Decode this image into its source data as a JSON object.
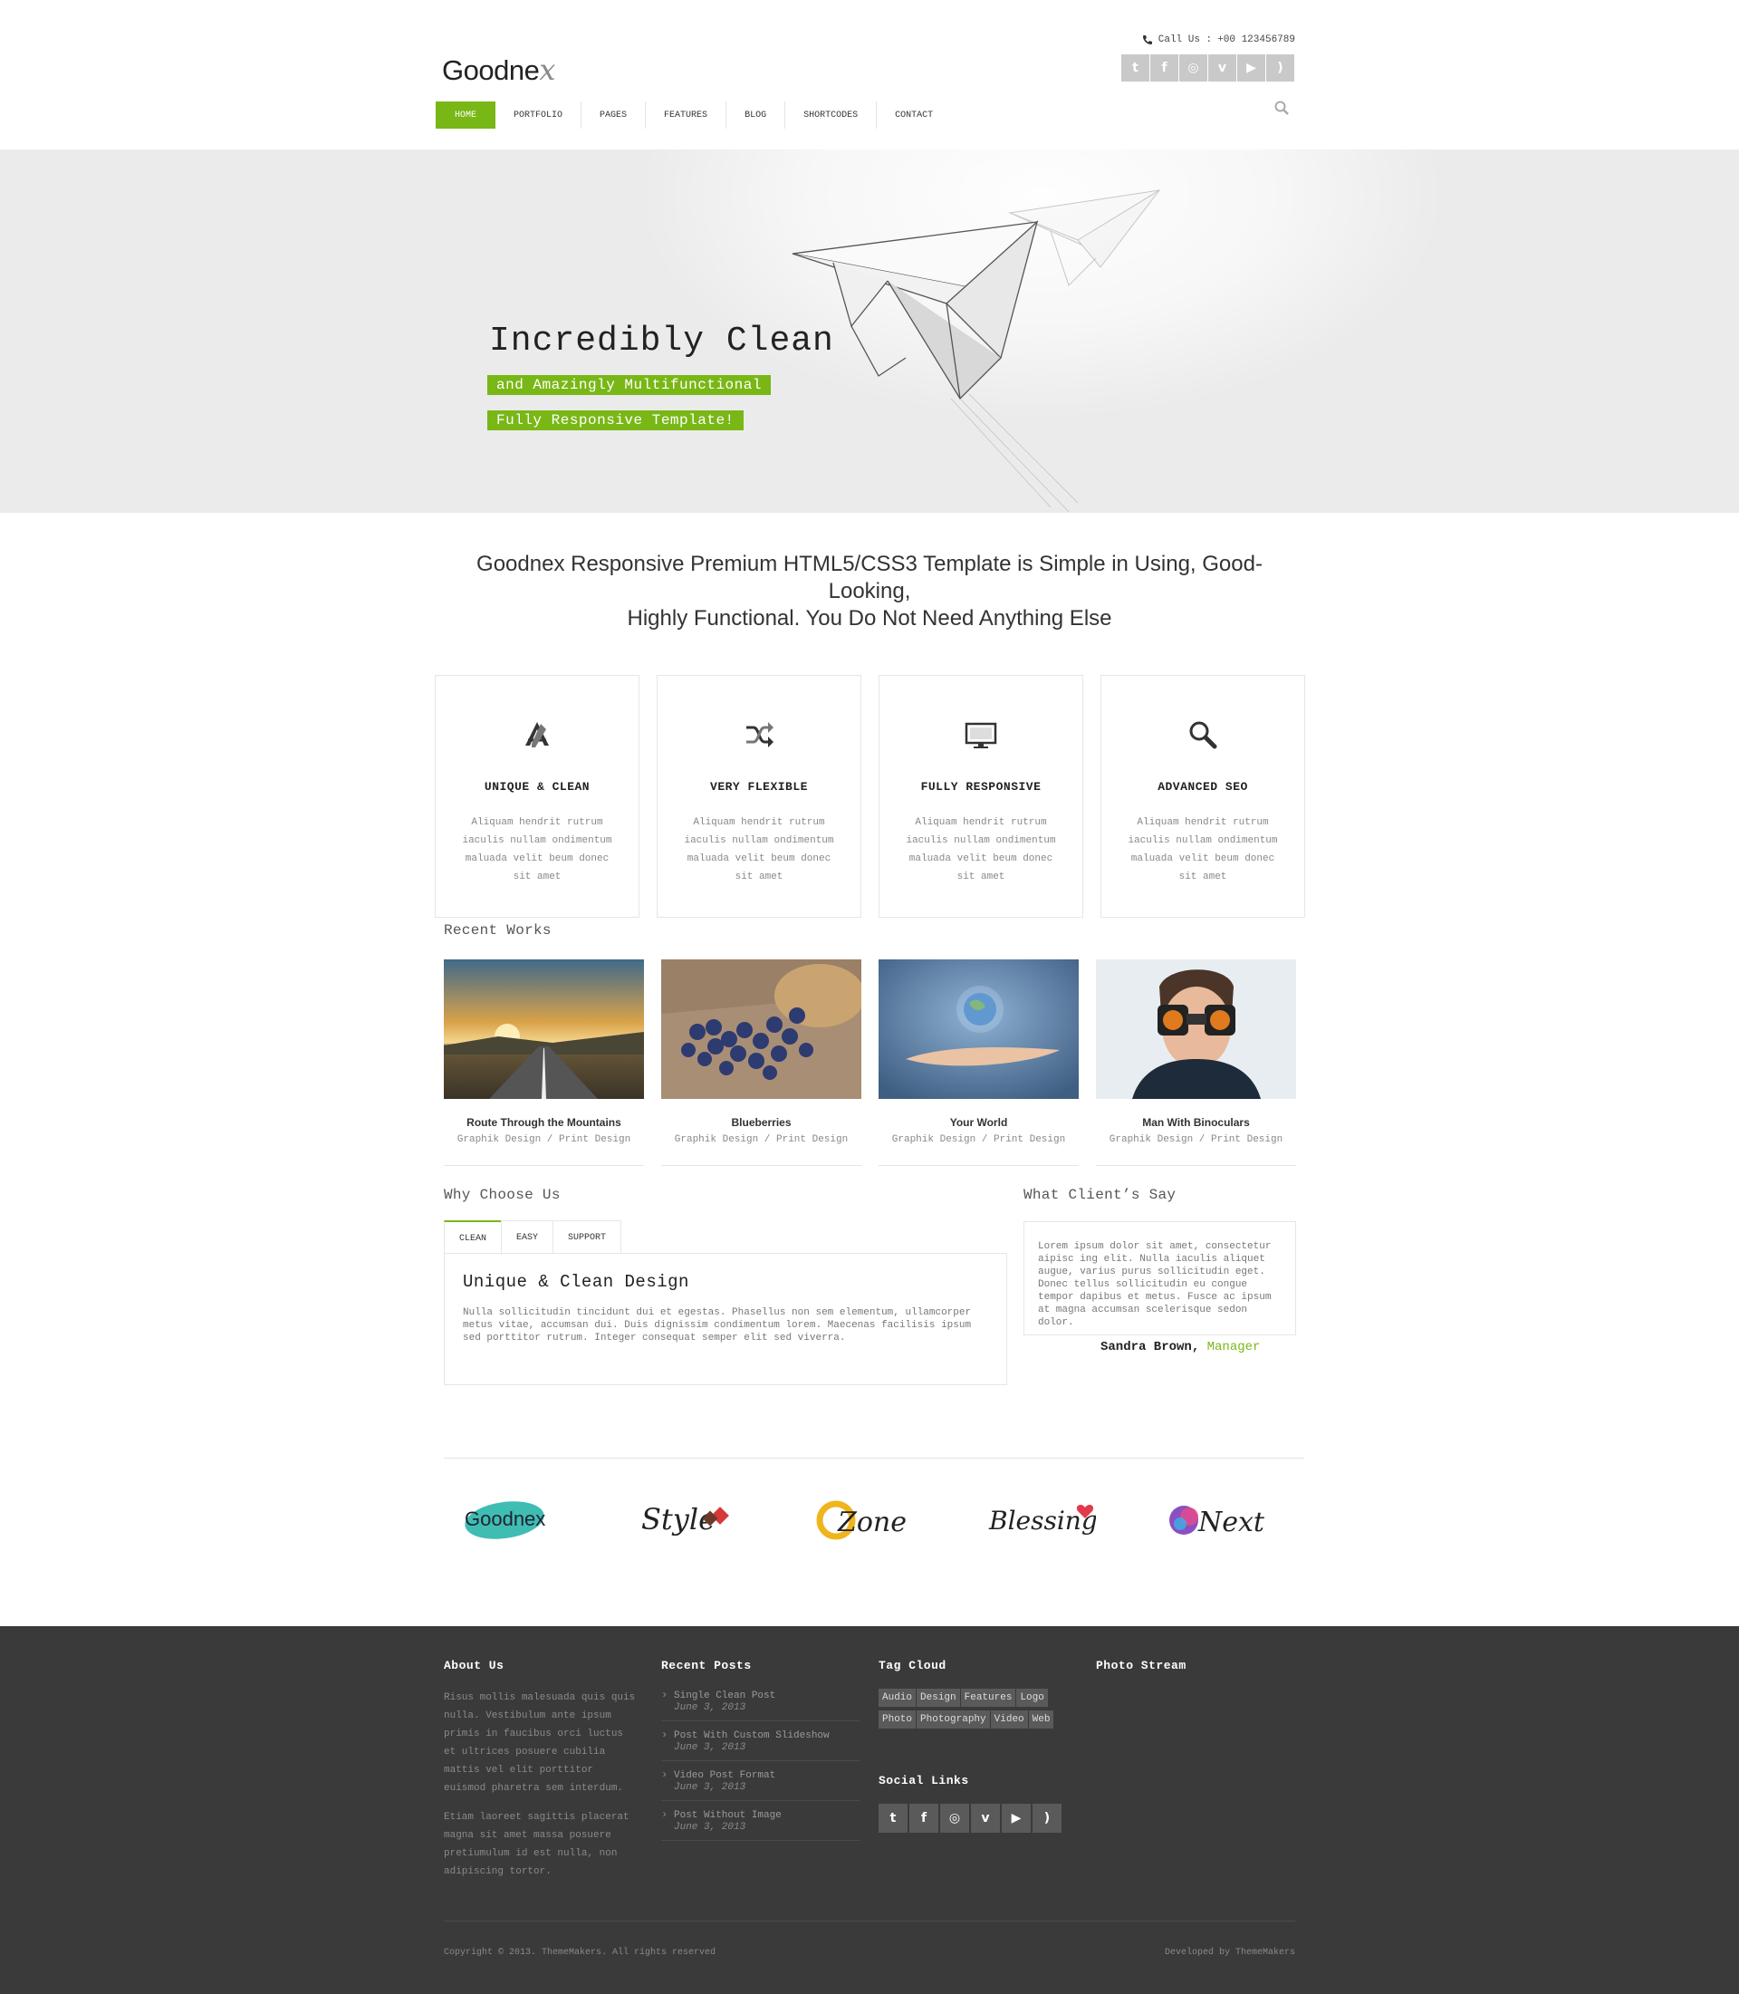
{
  "header": {
    "logo_text": "Goodne",
    "logo_mark": "x",
    "call_label": "Call Us :",
    "phone": "+00 123456789",
    "social": [
      {
        "icon": "twitter-icon",
        "glyph": "t"
      },
      {
        "icon": "facebook-icon",
        "glyph": "f"
      },
      {
        "icon": "dribbble-icon",
        "glyph": "◎"
      },
      {
        "icon": "vimeo-icon",
        "glyph": "v"
      },
      {
        "icon": "youtube-icon",
        "glyph": "▶"
      },
      {
        "icon": "rss-icon",
        "glyph": ")"
      }
    ]
  },
  "nav": [
    "HOME",
    "PORTFOLIO",
    "PAGES",
    "FEATURES",
    "BLOG",
    "SHORTCODES",
    "CONTACT"
  ],
  "hero": {
    "title": "Incredibly Clean",
    "tag1": "and Amazingly Multifunctional",
    "tag2": "Fully Responsive Template!"
  },
  "intro": {
    "line1": "Goodnex Responsive Premium HTML5/CSS3 Template is Simple in Using, Good-",
    "line2": "Looking,",
    "line3": "Highly Functional. You Do Not Need Anything Else"
  },
  "features": [
    {
      "title": "UNIQUE & CLEAN",
      "icon": "design-icon",
      "text": "Aliquam hendrit rutrum iaculis nullam ondimentum maluada velit beum donec sit amet"
    },
    {
      "title": "VERY FLEXIBLE",
      "icon": "shuffle-icon",
      "text": "Aliquam hendrit rutrum iaculis nullam ondimentum maluada velit beum donec sit amet"
    },
    {
      "title": "FULLY RESPONSIVE",
      "icon": "monitor-icon",
      "text": "Aliquam hendrit rutrum iaculis nullam ondimentum maluada velit beum donec sit amet"
    },
    {
      "title": "ADVANCED SEO",
      "icon": "search-icon",
      "text": "Aliquam hendrit rutrum iaculis nullam ondimentum maluada velit beum donec sit amet"
    }
  ],
  "recent_works": {
    "title": "Recent Works",
    "items": [
      {
        "title": "Route Through the Mountains",
        "category": "Graphik Design / Print Design"
      },
      {
        "title": "Blueberries",
        "category": "Graphik Design / Print Design"
      },
      {
        "title": "Your World",
        "category": "Graphik Design / Print Design"
      },
      {
        "title": "Man With Binoculars",
        "category": "Graphik Design / Print Design"
      }
    ]
  },
  "why": {
    "title": "Why Choose Us",
    "tabs": [
      "CLEAN",
      "EASY",
      "SUPPORT"
    ],
    "panel_title": "Unique & Clean Design",
    "panel_text": "Nulla sollicitudin tincidunt dui et egestas. Phasellus non sem elementum, ullamcorper metus vitae, accumsan dui. Duis dignissim condimentum lorem. Maecenas facilisis ipsum sed porttitor rutrum. Integer consequat semper elit sed viverra."
  },
  "testimonial": {
    "title": "What Client’s Say",
    "text": "Lorem ipsum dolor sit amet, consectetur aipisc ing elit. Nulla iaculis aliquet augue, varius purus sollicitudin eget. Donec tellus sollicitudin eu congue tempor dapibus et metus. Fusce ac ipsum at magna accumsan scelerisque sedon dolor.",
    "author": "Sandra Brown,",
    "role": "Manager"
  },
  "partners": [
    "Goodnex",
    "Style",
    "Zone",
    "Blessing",
    "Next"
  ],
  "footer": {
    "about_title": "About Us",
    "about_p1": "Risus mollis malesuada quis quis nulla. Vestibulum ante ipsum primis in faucibus orci luctus et ultrices posuere cubilia mattis vel elit porttitor euismod pharetra sem interdum.",
    "about_p2": "Etiam laoreet sagittis placerat magna sit amet massa posuere pretiumulum id est nulla, non adipiscing tortor.",
    "posts_title": "Recent Posts",
    "posts": [
      {
        "title": "Single Clean Post",
        "date": "June 3, 2013"
      },
      {
        "title": "Post With Custom Slideshow",
        "date": "June 3, 2013"
      },
      {
        "title": "Video Post Format",
        "date": "June 3, 2013"
      },
      {
        "title": "Post Without Image",
        "date": "June 3, 2013"
      }
    ],
    "tags_title": "Tag Cloud",
    "tags": [
      "Audio",
      "Design",
      "Features",
      "Logo",
      "Photo",
      "Photography",
      "Video",
      "Web"
    ],
    "social_title": "Social Links",
    "photo_title": "Photo Stream",
    "copyright": "Copyright © 2013. ThemeMakers. All rights reserved",
    "developed": "Developed by ThemeMakers"
  },
  "colors": {
    "accent": "#79b716",
    "footer_bg": "#3a3a3a"
  }
}
